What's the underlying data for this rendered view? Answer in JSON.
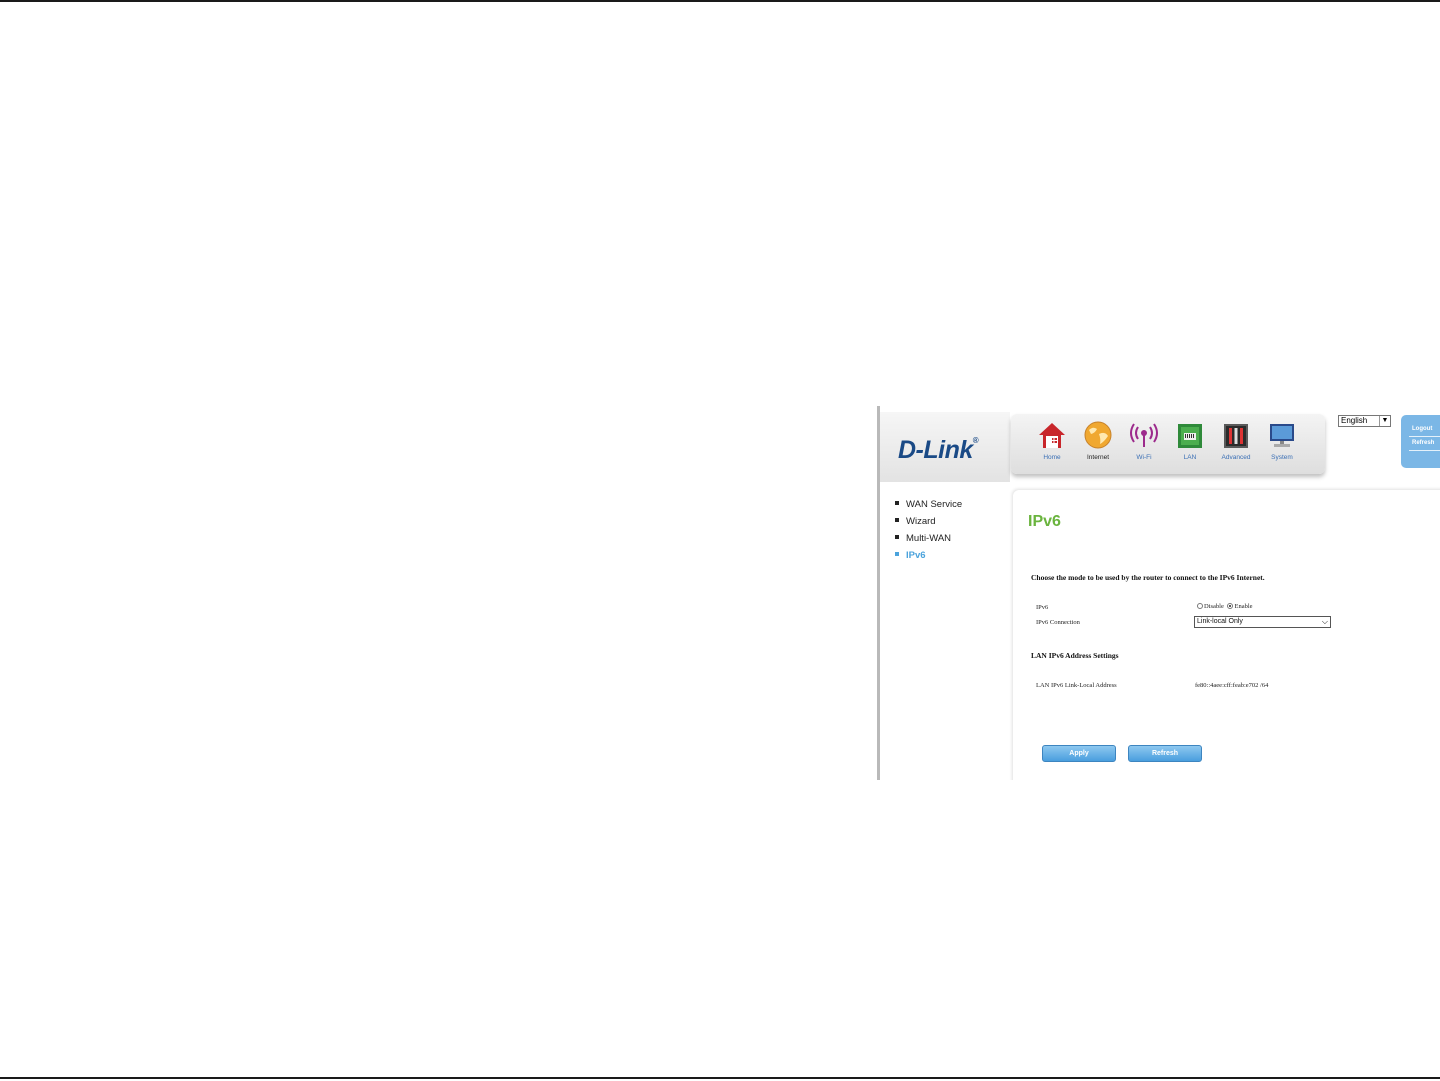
{
  "brand": {
    "logo": "D-Link",
    "reg_mark": "®"
  },
  "nav": {
    "items": [
      {
        "label": "Home",
        "icon": "home-icon"
      },
      {
        "label": "Internet",
        "icon": "globe-icon"
      },
      {
        "label": "Wi-Fi",
        "icon": "wifi-icon"
      },
      {
        "label": "LAN",
        "icon": "lan-icon"
      },
      {
        "label": "Advanced",
        "icon": "tools-icon"
      },
      {
        "label": "System",
        "icon": "monitor-icon"
      }
    ],
    "active": "Internet"
  },
  "language": {
    "selected": "English"
  },
  "account": {
    "logout_label": "Logout",
    "refresh_label": "Refresh"
  },
  "sidebar": {
    "items": [
      {
        "label": "WAN Service"
      },
      {
        "label": "Wizard"
      },
      {
        "label": "Multi-WAN"
      },
      {
        "label": "IPv6"
      }
    ],
    "active": "IPv6"
  },
  "main": {
    "title": "IPv6",
    "instruction": "Choose the mode to be used by the router to connect to the IPv6 Internet.",
    "ipv6_label": "IPv6",
    "ipv6_options": {
      "disable": "Disable",
      "enable": "Enable",
      "selected": "Enable"
    },
    "connection_label": "IPv6 Connection",
    "connection_value": "Link-local Only",
    "lan_section_title": "LAN IPv6 Address Settings",
    "lan_link_local_label": "LAN IPv6 Link-Local Address",
    "lan_link_local_value": "fe80::4aee:cff:feab:e702 /64",
    "apply_label": "Apply",
    "refresh_label": "Refresh"
  },
  "colors": {
    "title_green": "#6ab43e",
    "link_blue": "#3a6fb5",
    "active_blue": "#4ba3dc",
    "button_blue": "#4a9ede",
    "logo_blue": "#1a4a86"
  }
}
